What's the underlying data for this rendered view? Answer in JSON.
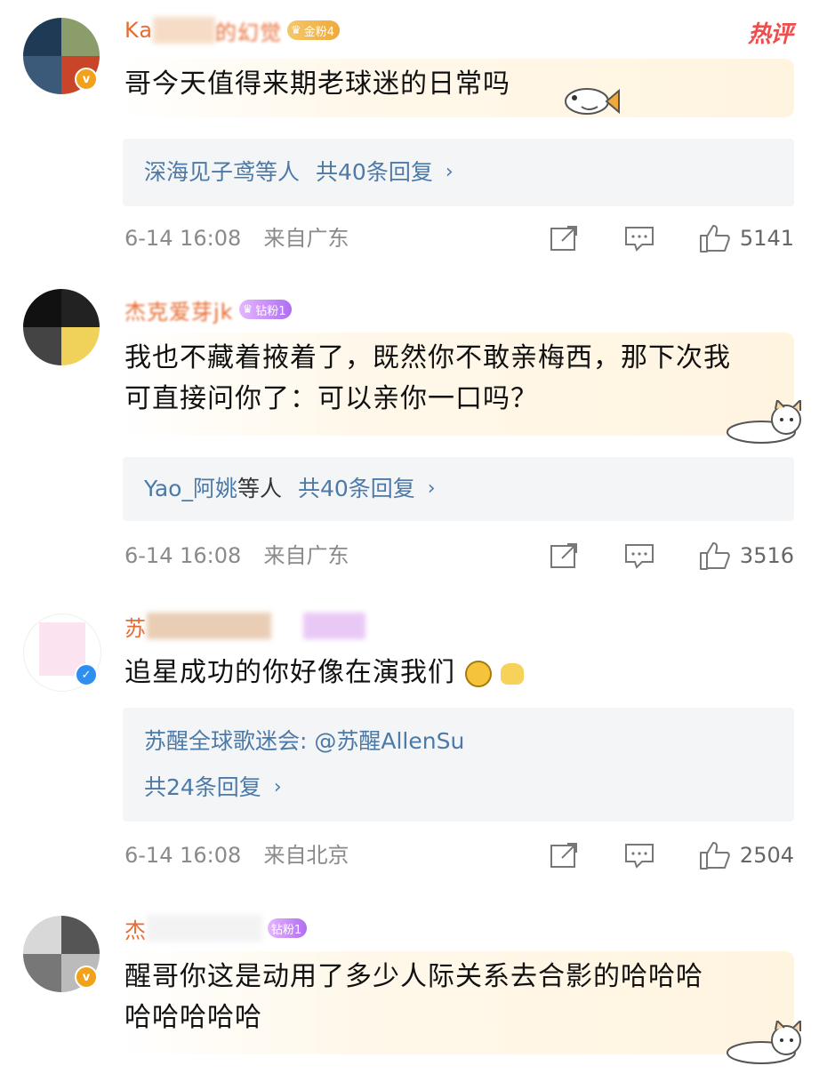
{
  "hot_label": "热评",
  "colors": {
    "name": "#e86a2f",
    "reply_link": "#4c79a7",
    "meta": "#8a8a8a",
    "hot": "#ef4d4d"
  },
  "comments": [
    {
      "name_visible": "Ka",
      "name_visible_tail": "的幻觉",
      "fan_badge": "金粉4",
      "verified": "gold",
      "text": "哥今天值得来期老球迷的日常吗",
      "reply_who": "深海见子鸢等人",
      "reply_count": "共40条回复",
      "date": "6-14 16:08",
      "location": "来自广东",
      "likes": "5141"
    },
    {
      "name_visible": "杰克爱芽jk",
      "fan_badge": "钻粉1",
      "verified": "none",
      "text_line1": "我也不藏着掖着了，既然你不敢亲梅西，那下次我",
      "text_line2": "可直接问你了：可以亲你一口吗？",
      "reply_who": "Yao_阿姚",
      "reply_who_suffix": "等人",
      "reply_count": "共40条回复",
      "date": "6-14 16:08",
      "location": "来自广东",
      "likes": "3516"
    },
    {
      "name_visible": "苏",
      "verified": "blue",
      "text": "追星成功的你好像在演我们",
      "reply_header": "苏醒全球歌迷会: @苏醒AllenSu",
      "reply_count": "共24条回复",
      "date": "6-14 16:08",
      "location": "来自北京",
      "likes": "2504"
    },
    {
      "name_visible": "杰",
      "fan_badge": "钻粉1",
      "verified": "gold",
      "text_line1": "醒哥你这是动用了多少人际关系去合影的哈哈哈",
      "text_line2": "哈哈哈哈哈"
    }
  ]
}
